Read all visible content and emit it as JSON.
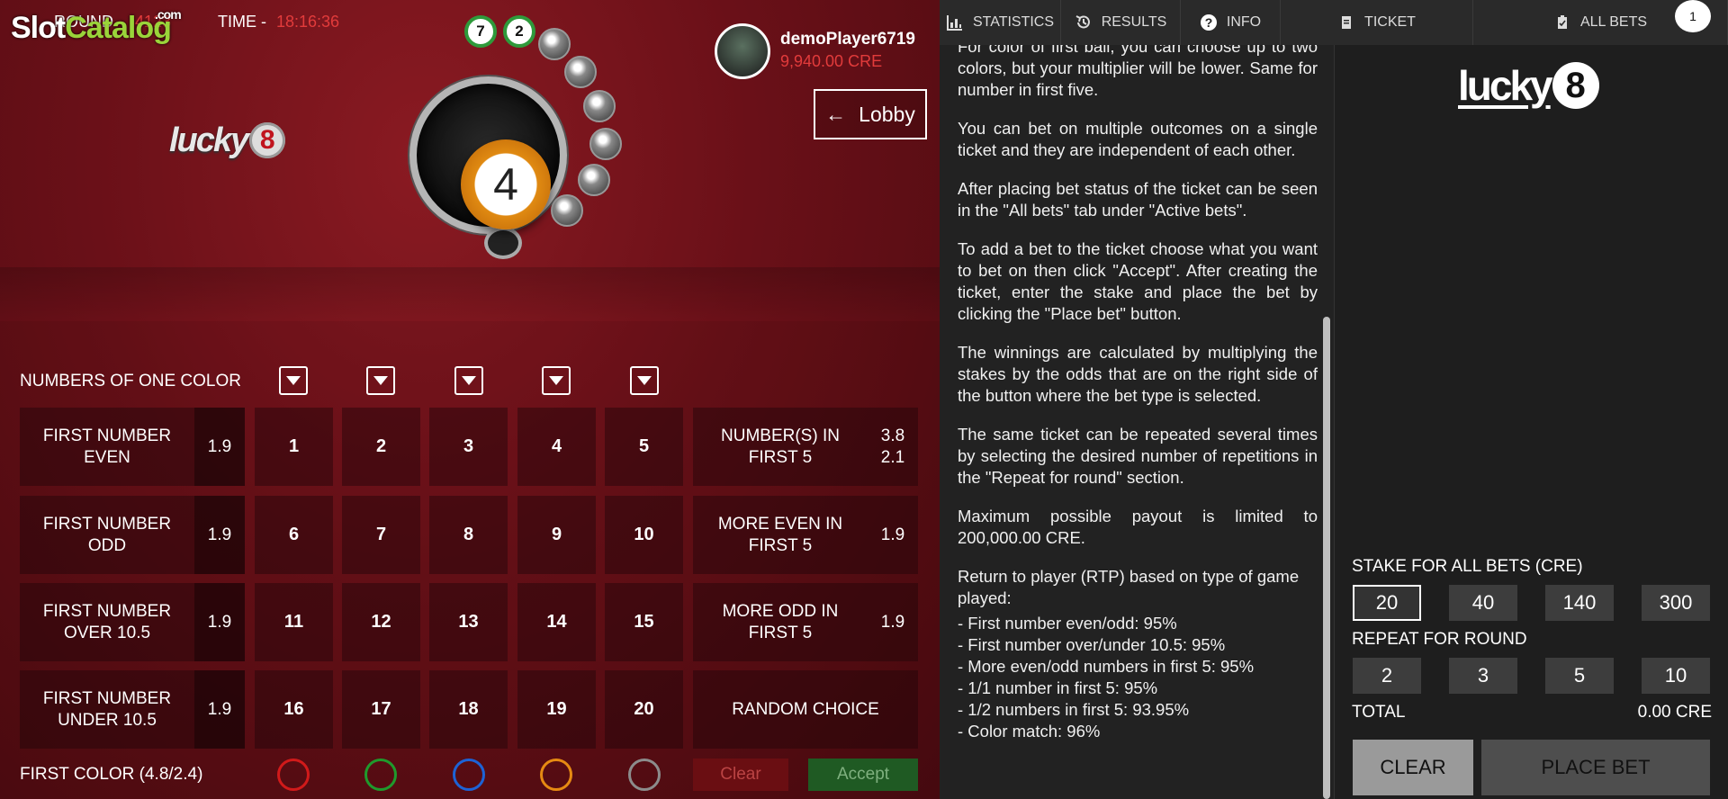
{
  "hud": {
    "round_label": "ROUND",
    "round_value": "4123",
    "time_label": "TIME -",
    "time_value": "18:16:36"
  },
  "watermark": {
    "slot": "Slot",
    "catalog": "Catalog",
    "com": ".com"
  },
  "game_logo": {
    "text": "lucky",
    "digit": "8"
  },
  "draw": {
    "current_ball": "4",
    "history": [
      "7",
      "2"
    ]
  },
  "player": {
    "name": "demoPlayer6719",
    "balance": "9,940.00 CRE"
  },
  "lobby": {
    "label": "Lobby",
    "arrow": "←"
  },
  "board": {
    "noc_label": "NUMBERS OF ONE COLOR",
    "left_bets": [
      {
        "label": "FIRST NUMBER EVEN",
        "odds": [
          "1.9"
        ]
      },
      {
        "label": "FIRST NUMBER ODD",
        "odds": [
          "1.9"
        ]
      },
      {
        "label": "FIRST NUMBER OVER 10.5",
        "odds": [
          "1.9"
        ]
      },
      {
        "label": "FIRST NUMBER UNDER 10.5",
        "odds": [
          "1.9"
        ]
      }
    ],
    "numbers": [
      "1",
      "2",
      "3",
      "4",
      "5",
      "6",
      "7",
      "8",
      "9",
      "10",
      "11",
      "12",
      "13",
      "14",
      "15",
      "16",
      "17",
      "18",
      "19",
      "20"
    ],
    "right_bets": [
      {
        "label": "NUMBER(S) IN FIRST 5",
        "odds": [
          "3.8",
          "2.1"
        ]
      },
      {
        "label": "MORE EVEN IN FIRST 5",
        "odds": [
          "1.9"
        ]
      },
      {
        "label": "MORE ODD IN FIRST 5",
        "odds": [
          "1.9"
        ]
      },
      {
        "label": "RANDOM CHOICE",
        "odds": []
      }
    ],
    "first_color_label": "FIRST COLOR (4.8/2.4)",
    "colors": [
      "#d11a1a",
      "#1f9a2c",
      "#1d63d6",
      "#e68a12",
      "#8c8c8c"
    ],
    "clear_label": "Clear",
    "accept_label": "Accept"
  },
  "tabs": [
    {
      "label": "STATISTICS",
      "icon": "bar-chart-icon"
    },
    {
      "label": "RESULTS",
      "icon": "history-icon"
    },
    {
      "label": "INFO",
      "icon": "question-icon"
    },
    {
      "label": "TICKET",
      "icon": "ticket-icon"
    },
    {
      "label": "ALL BETS",
      "icon": "clipboard-icon"
    }
  ],
  "badge": "1",
  "info": {
    "paragraphs": [
      "For color of first ball, you can choose up to two colors, but your multiplier will be lower. Same for number in first five.",
      "You can bet on multiple outcomes on a single ticket and they are independent of each other.",
      "After placing bet status of the ticket can be seen in the \"All bets\" tab under \"Active bets\".",
      "To add a bet to the ticket choose what you want to bet on then click \"Accept\". After creating the ticket, enter the stake and place the bet by clicking the \"Place bet\" button.",
      "The winnings are calculated by multiplying the stakes by the odds that are on the right side of the button where the bet type is selected.",
      "The same ticket can be repeated several times by selecting the desired number of repetitions in the \"Repeat for round\" section.",
      "Maximum possible payout is limited to 200,000.00 CRE."
    ],
    "rtp_heading": "Return to player (RTP) based on type of game played:",
    "rtp_items": [
      "- First number even/odd: 95%",
      "- First number over/under 10.5: 95%",
      "- More even/odd numbers in first 5: 95%",
      "- 1/1 number in first 5: 95%",
      "- 1/2 numbers in first 5: 93.95%",
      "- Color match: 96%"
    ]
  },
  "ticket": {
    "logo_text": "lucky",
    "logo_digit": "8",
    "stake_label": "STAKE FOR ALL BETS (CRE)",
    "stakes": [
      "20",
      "40",
      "140",
      "300"
    ],
    "selected_stake": "20",
    "repeat_label": "REPEAT FOR ROUND",
    "repeats": [
      "2",
      "3",
      "5",
      "10"
    ],
    "total_label": "TOTAL",
    "total_value": "0.00 CRE",
    "clear_label": "CLEAR",
    "place_label": "PLACE BET"
  }
}
